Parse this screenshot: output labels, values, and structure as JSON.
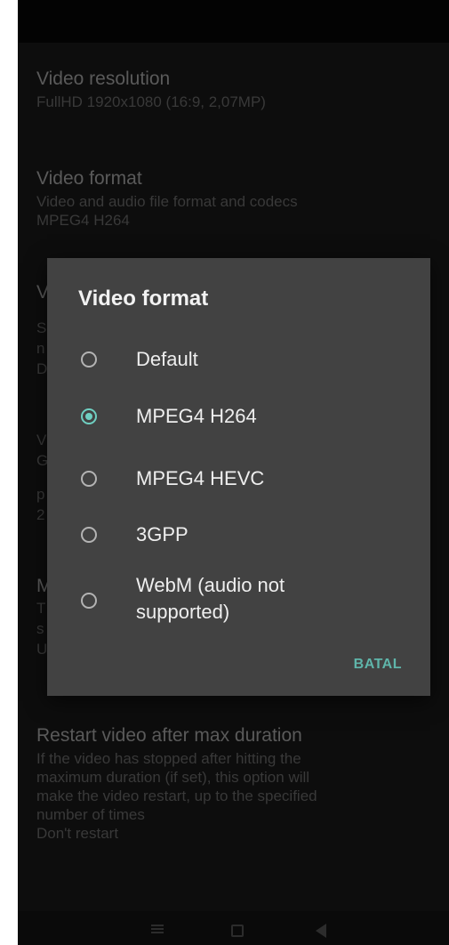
{
  "settings": {
    "video_resolution": {
      "title": "Video resolution",
      "summary": "FullHD 1920x1080 (16:9, 2,07MP)"
    },
    "video_format": {
      "title": "Video format",
      "summary_line1": "Video and audio file format and codecs",
      "summary_line2": "MPEG4 H264"
    },
    "hidden_fragments": {
      "a1": "V",
      "a2": "S",
      "a3": "n",
      "a4": "D",
      "b1": "V",
      "b2": "G",
      "b3": "p",
      "b4": "2",
      "c1": "M",
      "c2": "T",
      "c3": "s",
      "c4": "U"
    },
    "restart_video": {
      "title": "Restart video after max duration",
      "summary_line1": "If the video has stopped after hitting the",
      "summary_line2": "maximum duration (if set), this option will",
      "summary_line3": "make the video restart, up to the specified",
      "summary_line4": "number of times",
      "summary_line5": "Don't restart"
    }
  },
  "dialog": {
    "title": "Video format",
    "options": [
      {
        "label": "Default",
        "checked": false
      },
      {
        "label": "MPEG4 H264",
        "checked": true
      },
      {
        "label": "MPEG4 HEVC",
        "checked": false
      },
      {
        "label": "3GPP",
        "checked": false
      },
      {
        "label_line1": "WebM (audio not",
        "label_line2": "supported)",
        "checked": false
      }
    ],
    "cancel_label": "BATAL"
  },
  "colors": {
    "accent": "#6fcfc1",
    "dialog_bg": "#424242",
    "screen_bg": "#121212"
  },
  "icons": {
    "nav_menu": "menu-icon",
    "nav_home": "home-icon",
    "nav_back": "back-icon"
  }
}
